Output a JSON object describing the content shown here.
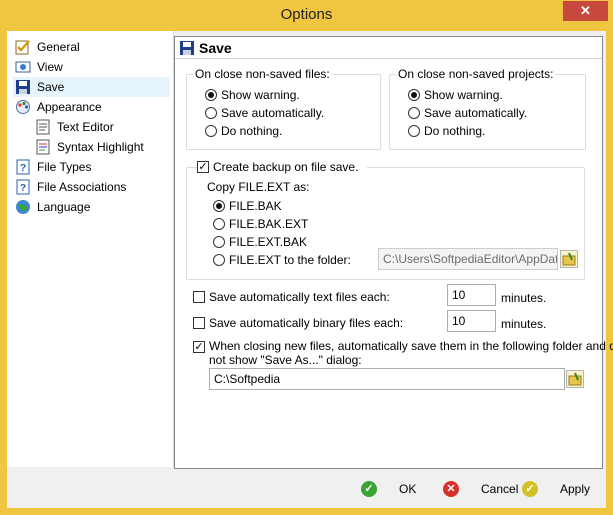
{
  "window": {
    "title": "Options",
    "close_glyph": "✕"
  },
  "sidebar": {
    "items": [
      {
        "label": "General",
        "icon": "checklist-icon"
      },
      {
        "label": "View",
        "icon": "view-icon"
      },
      {
        "label": "Save",
        "icon": "floppy-disk-icon",
        "selected": true
      },
      {
        "label": "Appearance",
        "icon": "appearance-icon"
      },
      {
        "label": "Text Editor",
        "icon": "text-editor-icon"
      },
      {
        "label": "Syntax Highlight",
        "icon": "syntax-highlight-icon"
      },
      {
        "label": "File Types",
        "icon": "file-types-icon"
      },
      {
        "label": "File Associations",
        "icon": "file-associations-icon"
      },
      {
        "label": "Language",
        "icon": "globe-icon"
      }
    ]
  },
  "panel": {
    "title": "Save",
    "on_close_files": {
      "title": "On close non-saved files:",
      "options": [
        "Show warning.",
        "Save automatically.",
        "Do nothing."
      ],
      "selected": 0
    },
    "on_close_projects": {
      "title": "On close non-saved projects:",
      "options": [
        "Show warning.",
        "Save automatically.",
        "Do nothing."
      ],
      "selected": 0
    },
    "backup": {
      "checkbox_label": "Create backup on file save.",
      "checked": true,
      "copy_as_label": "Copy FILE.EXT as:",
      "options": [
        "FILE.BAK",
        "FILE.BAK.EXT",
        "FILE.EXT.BAK",
        "FILE.EXT to the folder:"
      ],
      "selected": 0,
      "folder_value": "C:\\Users\\SoftpediaEditor\\AppData\\"
    },
    "auto_text": {
      "label": "Save automatically text files each:",
      "checked": false,
      "value": "10",
      "unit": "minutes."
    },
    "auto_binary": {
      "label": "Save automatically binary files each:",
      "checked": false,
      "value": "10",
      "unit": "minutes."
    },
    "new_files": {
      "label_line1": "When closing new files, automatically save them in the following folder and do",
      "label_line2": "not show \"Save As...\" dialog:",
      "checked": true,
      "folder_value": "C:\\Softpedia"
    }
  },
  "buttons": {
    "ok": "OK",
    "cancel": "Cancel",
    "apply": "Apply"
  },
  "colors": {
    "title_bar": "#f0c640",
    "ok": "#3aa535",
    "cancel": "#d8302a",
    "apply": "#d0c22a"
  }
}
